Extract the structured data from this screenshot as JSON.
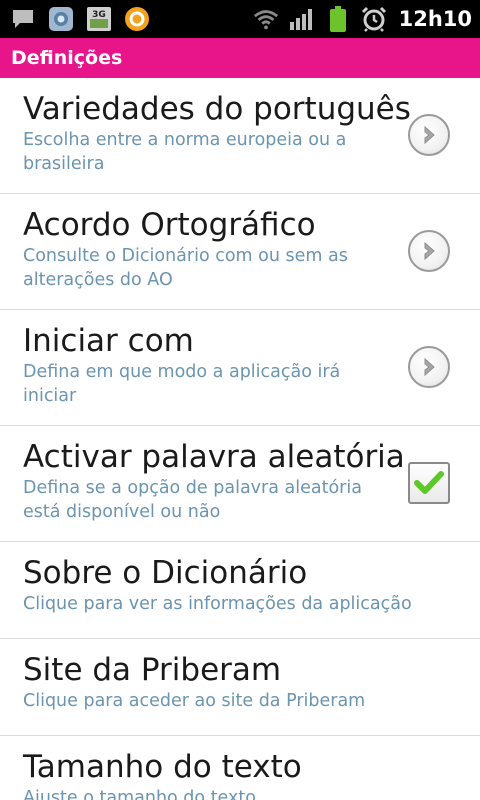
{
  "status_bar": {
    "time": "12h10",
    "network_label": "3G",
    "icons": [
      "message-icon",
      "camera-app-icon",
      "3g-icon",
      "orange-app-icon",
      "wifi-icon",
      "signal-icon",
      "battery-icon",
      "alarm-icon"
    ]
  },
  "header": {
    "title": "Definições"
  },
  "colors": {
    "accent": "#e8158a",
    "summary": "#6b94b0",
    "check": "#5ec82a"
  },
  "settings": [
    {
      "label": "Variedades do português",
      "summary": "Escolha entre a norma europeia ou a brasileira",
      "widget": "chevron"
    },
    {
      "label": "Acordo Ortográfico",
      "summary": "Consulte o Dicionário com ou sem as alterações do AO",
      "widget": "chevron"
    },
    {
      "label": "Iniciar com",
      "summary": "Defina em que modo a aplicação irá iniciar",
      "widget": "chevron"
    },
    {
      "label": "Activar palavra aleatória",
      "summary": "Defina se a opção de palavra aleatória está disponível ou não",
      "widget": "checkbox",
      "checked": true
    },
    {
      "label": "Sobre o Dicionário",
      "summary": "Clique para ver as informações da aplicação"
    },
    {
      "label": "Site da Priberam",
      "summary": "Clique para aceder ao site da Priberam"
    },
    {
      "label": "Tamanho do texto",
      "summary": "Ajuste o tamanho do texto"
    }
  ]
}
